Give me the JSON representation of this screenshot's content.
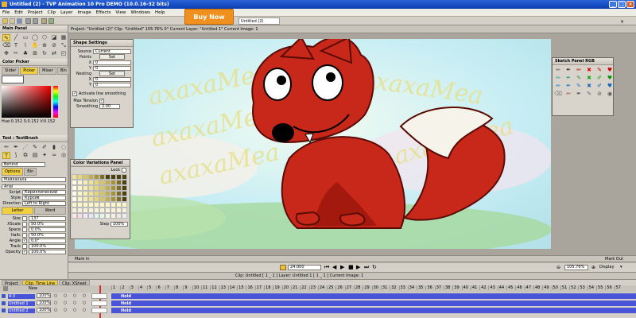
{
  "app": {
    "title": "Untitled (2) - TVP Animation 10 Pro DEMO (10.0.16-32 bits)",
    "buy_now": "Buy Now",
    "file_tab": "Untitled (2)"
  },
  "menu": [
    "File",
    "Edit",
    "Project",
    "Clip",
    "Layer",
    "Image",
    "Effects",
    "View",
    "Windows",
    "Help"
  ],
  "project_bar": "Project: \"Untitled (2)\"  Clip: \"Untitled\"  105.76%  0° Current Layer: \"Untitled 1\"  Current Image: 1",
  "left": {
    "main_panel": "Main Panel",
    "color_picker": "Color Picker",
    "color_tabs": [
      "Slider",
      "Picker",
      "Mixer",
      "Bin"
    ],
    "hsv": "Hue:0.152 S:0.152 V:0.152",
    "tool_header": "Tool : TextBrush",
    "blend": "Behind",
    "options_tabs": [
      "Options",
      "Bin"
    ],
    "text_value": "Маяхахаха",
    "font": "Arial",
    "script": {
      "label": "Script",
      "value": "Кириллический"
    },
    "style": {
      "label": "Style",
      "value": "Курсив"
    },
    "direction": {
      "label": "Direction",
      "value": "Left to Right"
    },
    "mode_tabs": [
      "Letter",
      "Word"
    ],
    "params": [
      {
        "label": "Size",
        "value": "137"
      },
      {
        "label": "XScale",
        "value": "50.0%"
      },
      {
        "label": "Space",
        "value": "0.0%"
      },
      {
        "label": "Italic",
        "value": "50.0%"
      },
      {
        "label": "Angle",
        "value": "0.0°"
      },
      {
        "label": "Track",
        "value": "100.0%"
      },
      {
        "label": "Opacity",
        "value": "100.0%"
      }
    ]
  },
  "shape_settings": {
    "title": "Shape Settings",
    "source_label": "Source",
    "source_value": "Current",
    "points": "Points",
    "set": "Set",
    "x_label": "X",
    "y_label": "Y",
    "zero": "0",
    "nesting": "Nesting",
    "smoothing_check": "Activate line smoothing",
    "max_tension": "Max Tension",
    "smoothing": "Smoothing",
    "smoothing_value": "2.00"
  },
  "color_variations": {
    "title": "Color Variations Panel",
    "lock": "Lock",
    "step_label": "Step",
    "step_value": "100%"
  },
  "sketch": {
    "title": "Sketch Panel RGB"
  },
  "canvas": {
    "watermark_text": "ахахаМеа",
    "colors": {
      "fox": "#c8281a",
      "fox_dark": "#8e1408",
      "tail_tip": "#f6f3ea",
      "sky": "#c8eef4",
      "grass": "#a7d9a2"
    }
  },
  "mark_bar": {
    "mark_in": "Mark In",
    "mark_out": "Mark Out"
  },
  "transport": {
    "fps": "24.000",
    "zoom": "105.76%",
    "display": "Display"
  },
  "clip_bar": "Clip: Untitled [ 1 _ 1 ]    Layer: Untitled 1 [ 1 _ 1 ]    Current Image: 1",
  "bottom_tabs": [
    "Project",
    "Clip: Time Line",
    "Clip: XSheet"
  ],
  "timeline": {
    "new_label": "New",
    "layers": [
      {
        "name": "4:3",
        "opacity": "100%",
        "hold": "Hold"
      },
      {
        "name": "Untitled 1",
        "opacity": "100%",
        "hold": "Hold"
      },
      {
        "name": "Untitled 2",
        "opacity": "100%",
        "hold": "Hold"
      }
    ],
    "frames": [
      "1",
      "2",
      "3",
      "4",
      "5",
      "6",
      "7",
      "8",
      "9",
      "10",
      "11",
      "12",
      "13",
      "14",
      "15",
      "16",
      "17",
      "18",
      "19",
      "20",
      "21",
      "22",
      "23",
      "24",
      "25",
      "26",
      "27",
      "28",
      "29",
      "30",
      "31",
      "32",
      "33",
      "34",
      "35",
      "36",
      "37",
      "38",
      "39",
      "40",
      "41",
      "42",
      "43",
      "44",
      "45",
      "46",
      "47",
      "48",
      "49",
      "50",
      "51",
      "52",
      "53",
      "54",
      "55",
      "56",
      "57"
    ]
  }
}
